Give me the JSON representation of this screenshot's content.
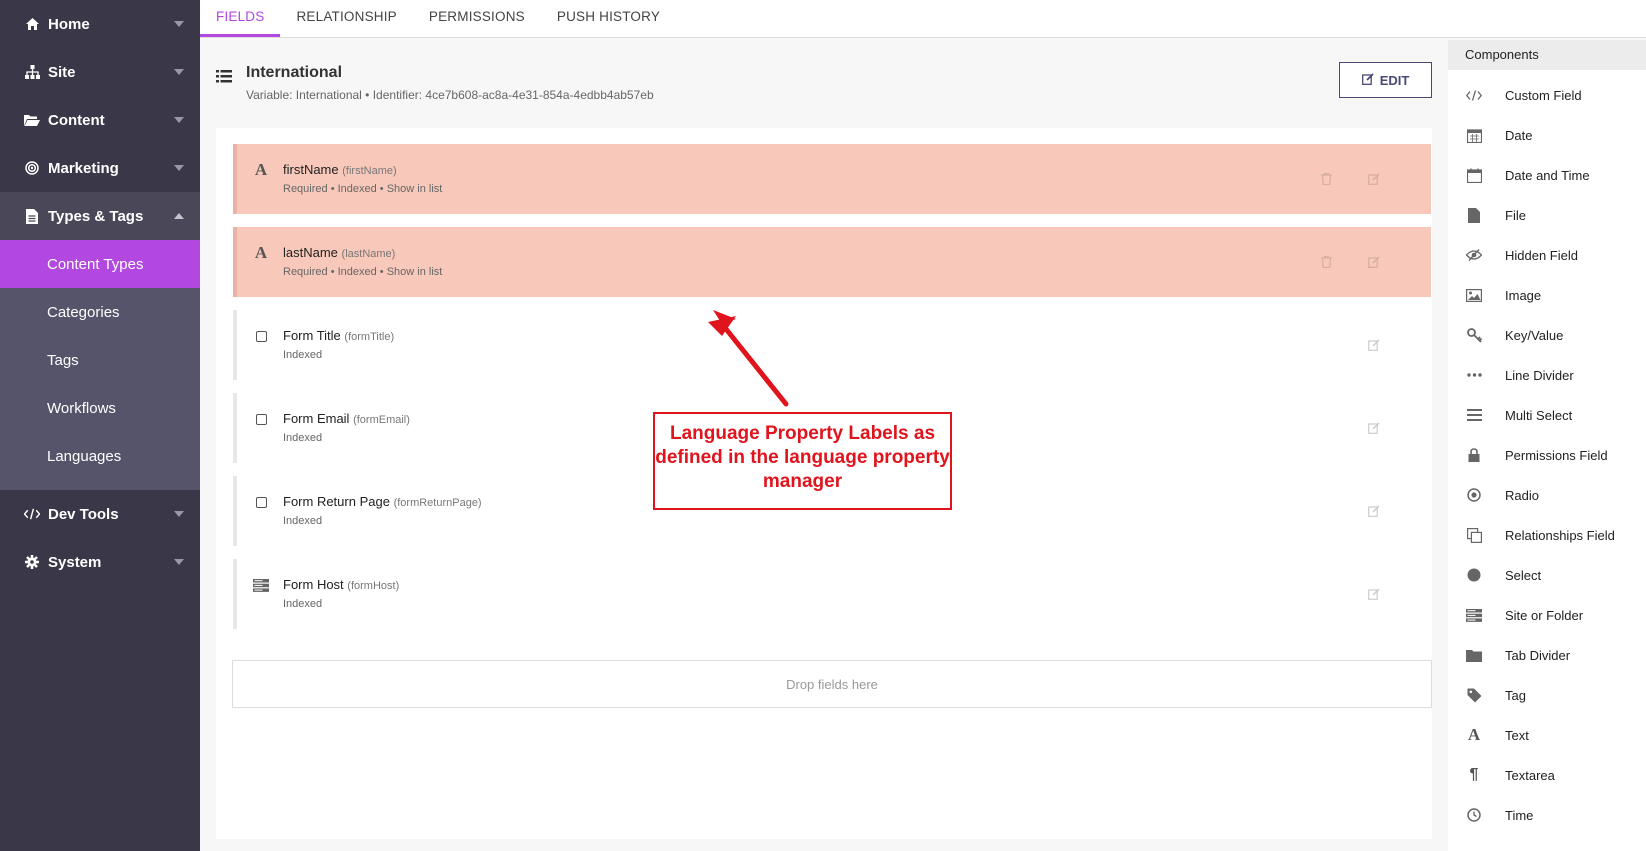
{
  "sidebar": {
    "items": [
      {
        "label": "Home",
        "icon": "home-icon"
      },
      {
        "label": "Site",
        "icon": "sitemap-icon"
      },
      {
        "label": "Content",
        "icon": "folder-open-icon"
      },
      {
        "label": "Marketing",
        "icon": "target-icon"
      },
      {
        "label": "Types & Tags",
        "icon": "file-text-icon"
      }
    ],
    "subitems": [
      "Content Types",
      "Categories",
      "Tags",
      "Workflows",
      "Languages"
    ],
    "bottom_items": [
      {
        "label": "Dev Tools",
        "icon": "code-icon"
      },
      {
        "label": "System",
        "icon": "gear-icon"
      }
    ]
  },
  "tabs": [
    "FIELDS",
    "RELATIONSHIP",
    "PERMISSIONS",
    "PUSH HISTORY"
  ],
  "content_type": {
    "title": "International",
    "meta": "Variable: International  •  Identifier: 4ce7b608-ac8a-4e31-854a-4edbb4ab57eb",
    "edit_label": "EDIT"
  },
  "fields": [
    {
      "name": "firstName",
      "var": "(firstName)",
      "meta": "Required  •  Indexed  •  Show in list",
      "icon": "text-icon"
    },
    {
      "name": "lastName",
      "var": "(lastName)",
      "meta": "Required  •  Indexed  •  Show in list",
      "icon": "text-icon"
    },
    {
      "name": "Form Title",
      "var": "(formTitle)",
      "meta": "Indexed",
      "icon": "checkbox-icon"
    },
    {
      "name": "Form Email",
      "var": "(formEmail)",
      "meta": "Indexed",
      "icon": "checkbox-icon"
    },
    {
      "name": "Form Return Page",
      "var": "(formReturnPage)",
      "meta": "Indexed",
      "icon": "checkbox-icon"
    },
    {
      "name": "Form Host",
      "var": "(formHost)",
      "meta": "Indexed",
      "icon": "server-icon"
    }
  ],
  "dropzone": "Drop fields here",
  "annotation": "Language Property Labels as defined in the language property manager",
  "components": {
    "header": "Components",
    "items": [
      {
        "label": "Custom Field",
        "icon": "code-icon"
      },
      {
        "label": "Date",
        "icon": "calendar-icon"
      },
      {
        "label": "Date and Time",
        "icon": "calendar-outline-icon"
      },
      {
        "label": "File",
        "icon": "file-icon"
      },
      {
        "label": "Hidden Field",
        "icon": "eye-slash-icon"
      },
      {
        "label": "Image",
        "icon": "image-icon"
      },
      {
        "label": "Key/Value",
        "icon": "key-icon"
      },
      {
        "label": "Line Divider",
        "icon": "ellipsis-icon"
      },
      {
        "label": "Multi Select",
        "icon": "list-icon"
      },
      {
        "label": "Permissions Field",
        "icon": "lock-icon"
      },
      {
        "label": "Radio",
        "icon": "radio-icon"
      },
      {
        "label": "Relationships Field",
        "icon": "copy-icon"
      },
      {
        "label": "Select",
        "icon": "circle-icon"
      },
      {
        "label": "Site or Folder",
        "icon": "server-icon"
      },
      {
        "label": "Tab Divider",
        "icon": "folder-icon"
      },
      {
        "label": "Tag",
        "icon": "tag-icon"
      },
      {
        "label": "Text",
        "icon": "text-icon"
      },
      {
        "label": "Textarea",
        "icon": "paragraph-icon"
      },
      {
        "label": "Time",
        "icon": "clock-icon"
      }
    ]
  },
  "colors": {
    "sidebar_bg": "#3a3848",
    "accent": "#b248e0",
    "highlight_field": "#f8c9bb",
    "annotation_red": "#e0141d"
  }
}
